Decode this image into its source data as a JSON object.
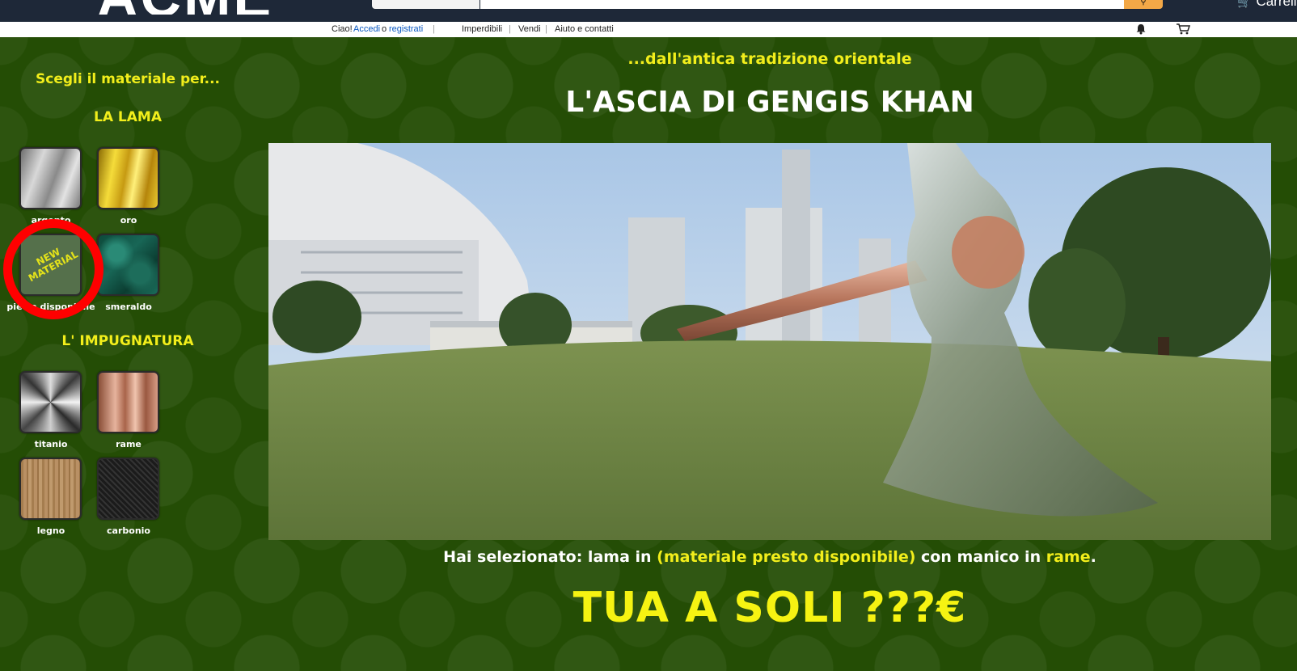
{
  "header": {
    "logo": "ACME",
    "search_placeholder": "",
    "cart_label": "Carrello"
  },
  "subnav": {
    "greeting": "Ciao!",
    "login": "Accedi",
    "or": "o",
    "register": "registrati",
    "links": [
      "Imperdibili",
      "Vendi",
      "Aiuto e contatti"
    ]
  },
  "sidebar": {
    "intro": "Scegli il materiale per...",
    "blade_heading": "LA LAMA",
    "blade_materials": [
      {
        "label": "argento"
      },
      {
        "label": "oro"
      },
      {
        "label": "pietra disponibile",
        "badge": "NEW MATERIAL"
      },
      {
        "label": "smeraldo"
      }
    ],
    "handle_heading": "L' IMPUGNATURA",
    "handle_materials": [
      {
        "label": "titanio"
      },
      {
        "label": "rame"
      },
      {
        "label": "legno"
      },
      {
        "label": "carbonio"
      }
    ]
  },
  "main": {
    "subtitle": "...dall'antica tradizione orientale",
    "title": "L'ASCIA DI GENGIS KHAN",
    "selection_prefix": "Hai selezionato: lama in ",
    "selection_blade": "(materiale presto disponibile)",
    "selection_middle": " con manico in ",
    "selection_handle": "rame",
    "selection_suffix": ".",
    "price": "TUA A SOLI ???€"
  },
  "colors": {
    "background": "#244d05",
    "accent_yellow": "#f2ee1b",
    "highlight_circle": "#ff0000",
    "topbar": "#1e2838"
  }
}
